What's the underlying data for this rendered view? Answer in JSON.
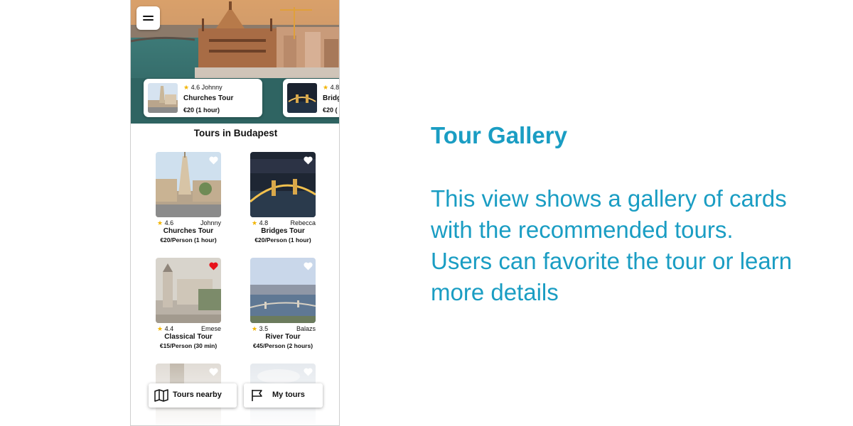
{
  "app": {
    "menu_icon": "hamburger-menu-icon"
  },
  "featured_tours": [
    {
      "rating": "4.6",
      "guide": "Johnny",
      "name": "Churches Tour",
      "price": "€20 (1 hour)"
    },
    {
      "rating": "4.8",
      "guide": "",
      "name": "Bridg",
      "price": "€20 ("
    }
  ],
  "section": {
    "title": "Tours in Budapest"
  },
  "tours": [
    {
      "rating": "4.6",
      "guide": "Johnny",
      "name": "Churches Tour",
      "price": "€20/Person (1 hour)",
      "favorite": false
    },
    {
      "rating": "4.8",
      "guide": "Rebecca",
      "name": "Bridges Tour",
      "price": "€20/Person (1 hour)",
      "favorite": false
    },
    {
      "rating": "4.4",
      "guide": "Emese",
      "name": "Classical Tour",
      "price": "€15/Person (30 min)",
      "favorite": true
    },
    {
      "rating": "3.5",
      "guide": "Balazs",
      "name": "River Tour",
      "price": "€45/Person (2 hours)",
      "favorite": false
    }
  ],
  "bottom_nav": {
    "nearby_label": "Tours nearby",
    "nearby_icon": "map-icon",
    "mytours_label": "My tours",
    "mytours_icon": "flag-icon"
  },
  "description": {
    "title": "Tour Gallery",
    "body": "This view shows a gallery of cards with the recommended tours. Users can favorite the tour or learn more details"
  },
  "colors": {
    "accent": "#1a9dc3",
    "star": "#f2b400",
    "favorite_heart": "#e8121b"
  }
}
